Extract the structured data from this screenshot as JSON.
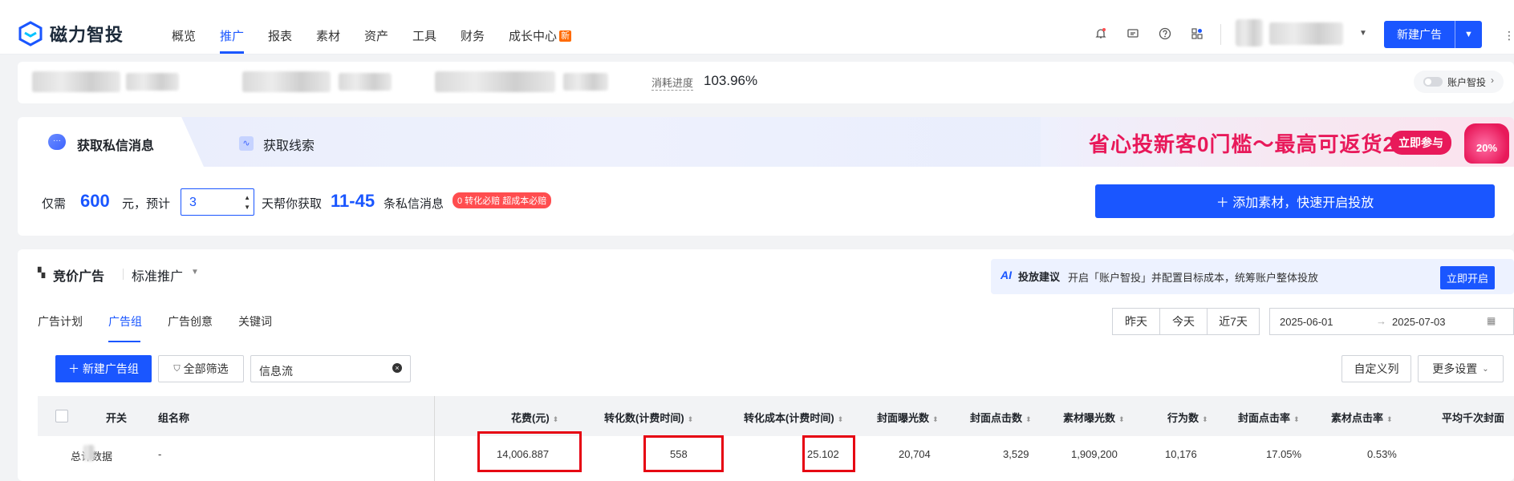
{
  "brand": {
    "name": "磁力智投"
  },
  "nav": {
    "items": [
      "概览",
      "推广",
      "报表",
      "素材",
      "资产",
      "工具",
      "财务",
      "成长中心"
    ],
    "active": "推广",
    "new_badge": "新"
  },
  "header": {
    "new_ad_button": "新建广告"
  },
  "account": {
    "progress_label": "消耗进度",
    "progress_value": "103.96%",
    "smart_label": "账户智投"
  },
  "promo": {
    "tab_private_msg": "获取私信消息",
    "tab_leads": "获取线索",
    "banner_text": "省心投新客0门槛～最高可返货20%",
    "banner_button": "立即参与",
    "banner_gift": "20%",
    "text_only": "仅需",
    "amount": "600",
    "text_yuan_est": "元，预计",
    "days_value": "3",
    "text_days": "天帮你获取",
    "range": "11-45",
    "text_msgs": "条私信消息",
    "tag": "0 转化必赔 超成本必赔",
    "add_button": "＋ 添加素材，快速开启投放"
  },
  "section": {
    "title": "竞价广告",
    "mode": "标准推广",
    "ai_label": "投放建议",
    "ai_text": "开启「账户智投」并配置目标成本，统筹账户整体投放",
    "ai_button": "立即开启"
  },
  "subtabs": {
    "items": [
      "广告计划",
      "广告组",
      "广告创意",
      "关键词"
    ],
    "active": "广告组"
  },
  "date_filter": {
    "quick": [
      "昨天",
      "今天",
      "近7天"
    ],
    "start": "2025-06-01",
    "end": "2025-07-03"
  },
  "toolbar": {
    "new_group": "＋ 新建广告组",
    "filter_all": "全部筛选",
    "search_value": "信息流",
    "custom_cols": "自定义列",
    "more_settings": "更多设置"
  },
  "table": {
    "headers": {
      "switch": "开关",
      "name": "组名称",
      "cost": "花费(元)",
      "conversions": "转化数(计费时间)",
      "cpa": "转化成本(计费时间)",
      "cover_impr": "封面曝光数",
      "cover_clicks": "封面点击数",
      "material_impr": "素材曝光数",
      "actions": "行为数",
      "cover_ctr": "封面点击率",
      "material_ctr": "素材点击率",
      "avg_cpm": "平均千次封面"
    },
    "total_row": {
      "label": "总计数据",
      "name": "-",
      "cost": "14,006.887",
      "conversions": "558",
      "cpa": "25.102",
      "cover_impr": "20,704",
      "cover_clicks": "3,529",
      "material_impr": "1,909,200",
      "actions": "10,176",
      "cover_ctr": "17.05%",
      "material_ctr": "0.53%"
    }
  }
}
